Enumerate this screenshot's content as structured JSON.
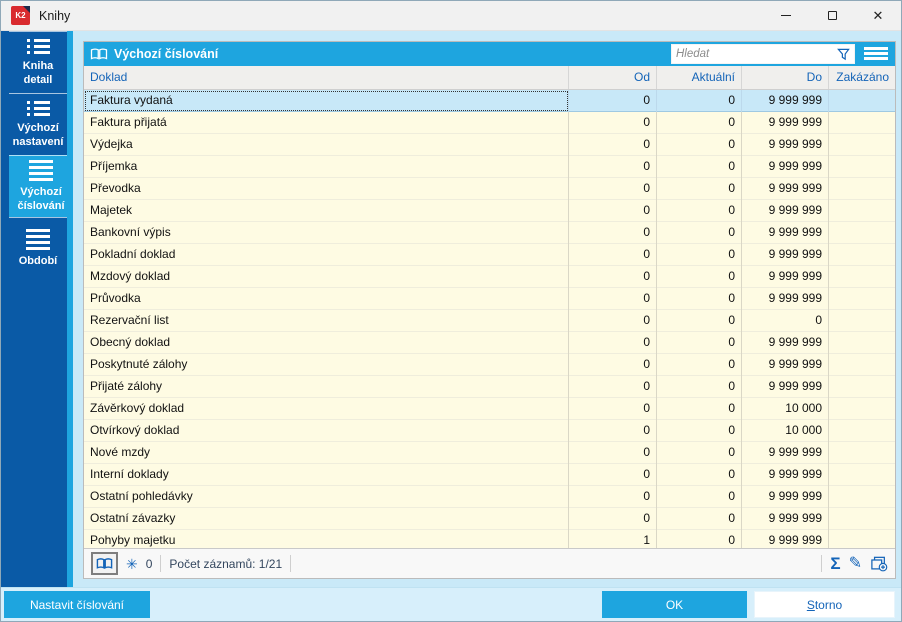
{
  "window": {
    "title": "Knihy",
    "logo_text": "K2"
  },
  "sidebar": {
    "items": [
      {
        "label": "Kniha detail",
        "icon": "list-detail-icon",
        "active": false
      },
      {
        "label": "Výchozí nastavení",
        "icon": "list-detail-icon",
        "active": false
      },
      {
        "label": "Výchozí číslování",
        "icon": "menu-lines-icon",
        "active": true
      },
      {
        "label": "Období",
        "icon": "menu-lines-icon",
        "active": false
      }
    ]
  },
  "panel": {
    "title": "Výchozí číslování",
    "search": {
      "placeholder": "Hledat"
    }
  },
  "table": {
    "columns": [
      {
        "label": "Doklad",
        "align": "left"
      },
      {
        "label": "Od",
        "align": "right"
      },
      {
        "label": "Aktuální",
        "align": "right"
      },
      {
        "label": "Do",
        "align": "right"
      },
      {
        "label": "Zakázáno",
        "align": "right"
      }
    ],
    "selected_row_index": 0,
    "rows": [
      [
        "Faktura vydaná",
        "0",
        "0",
        "9 999 999",
        ""
      ],
      [
        "Faktura přijatá",
        "0",
        "0",
        "9 999 999",
        ""
      ],
      [
        "Výdejka",
        "0",
        "0",
        "9 999 999",
        ""
      ],
      [
        "Příjemka",
        "0",
        "0",
        "9 999 999",
        ""
      ],
      [
        "Převodka",
        "0",
        "0",
        "9 999 999",
        ""
      ],
      [
        "Majetek",
        "0",
        "0",
        "9 999 999",
        ""
      ],
      [
        "Bankovní výpis",
        "0",
        "0",
        "9 999 999",
        ""
      ],
      [
        "Pokladní doklad",
        "0",
        "0",
        "9 999 999",
        ""
      ],
      [
        "Mzdový doklad",
        "0",
        "0",
        "9 999 999",
        ""
      ],
      [
        "Průvodka",
        "0",
        "0",
        "9 999 999",
        ""
      ],
      [
        "Rezervační list",
        "0",
        "0",
        "0",
        ""
      ],
      [
        "Obecný doklad",
        "0",
        "0",
        "9 999 999",
        ""
      ],
      [
        "Poskytnuté zálohy",
        "0",
        "0",
        "9 999 999",
        ""
      ],
      [
        "Přijaté zálohy",
        "0",
        "0",
        "9 999 999",
        ""
      ],
      [
        "Závěrkový doklad",
        "0",
        "0",
        "10 000",
        ""
      ],
      [
        "Otvírkový doklad",
        "0",
        "0",
        "10 000",
        ""
      ],
      [
        "Nové mzdy",
        "0",
        "0",
        "9 999 999",
        ""
      ],
      [
        "Interní doklady",
        "0",
        "0",
        "9 999 999",
        ""
      ],
      [
        "Ostatní pohledávky",
        "0",
        "0",
        "9 999 999",
        ""
      ],
      [
        "Ostatní závazky",
        "0",
        "0",
        "9 999 999",
        ""
      ],
      [
        "Pohyby majetku",
        "1",
        "0",
        "9 999 999",
        ""
      ]
    ]
  },
  "statusbar": {
    "star_icon": "✳",
    "star_count": "0",
    "records_label": "Počet záznamů: 1/21",
    "sigma_icon": "Σ",
    "pencil_icon": "✎"
  },
  "footer": {
    "setup_label": "Nastavit číslování",
    "ok_label": "OK",
    "cancel_label": "Storno"
  },
  "colors": {
    "sidebar_blue": "#0A5AA6",
    "accent_cyan": "#1EA5DF",
    "row_cream": "#FEFBE3",
    "selected_row": "#C8E8F8",
    "header_text_blue": "#1464B8"
  }
}
